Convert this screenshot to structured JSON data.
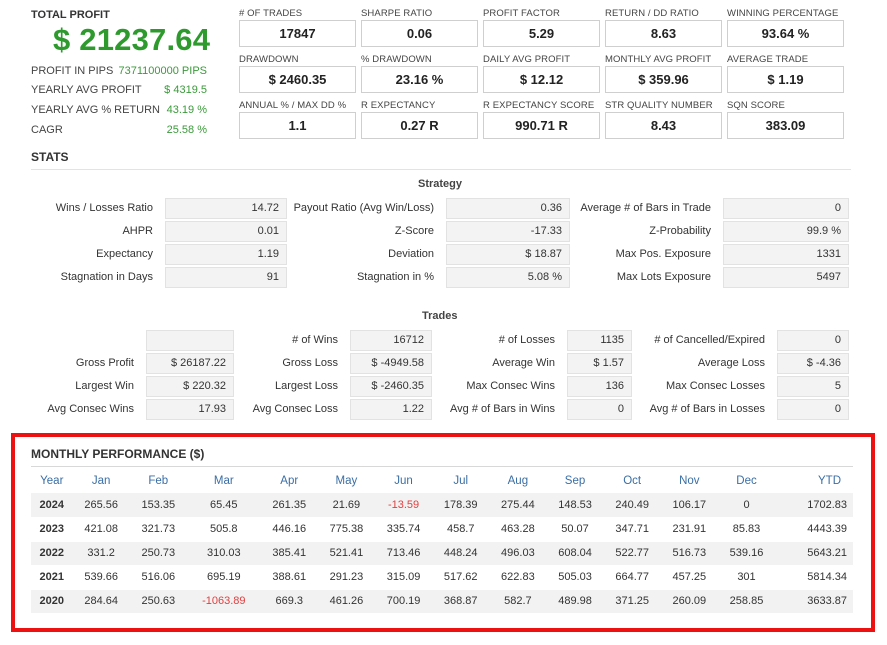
{
  "summary": {
    "total_profit_label": "TOTAL PROFIT",
    "total_profit_value": "$ 21237.64",
    "rows": [
      {
        "label": "PROFIT IN PIPS",
        "value": "7371100000 PIPS"
      },
      {
        "label": "YEARLY AVG PROFIT",
        "value": "$ 4319.5"
      },
      {
        "label": "YEARLY AVG % RETURN",
        "value": "43.19 %"
      },
      {
        "label": "CAGR",
        "value": "25.58 %"
      }
    ]
  },
  "metrics": [
    {
      "label": "# OF TRADES",
      "value": "17847"
    },
    {
      "label": "SHARPE RATIO",
      "value": "0.06"
    },
    {
      "label": "PROFIT FACTOR",
      "value": "5.29"
    },
    {
      "label": "RETURN / DD RATIO",
      "value": "8.63"
    },
    {
      "label": "WINNING PERCENTAGE",
      "value": "93.64 %"
    },
    {
      "label": "DRAWDOWN",
      "value": "$ 2460.35"
    },
    {
      "label": "% DRAWDOWN",
      "value": "23.16 %"
    },
    {
      "label": "DAILY AVG PROFIT",
      "value": "$ 12.12"
    },
    {
      "label": "MONTHLY AVG PROFIT",
      "value": "$ 359.96"
    },
    {
      "label": "AVERAGE TRADE",
      "value": "$ 1.19"
    },
    {
      "label": "ANNUAL % / MAX DD %",
      "value": "1.1"
    },
    {
      "label": "R EXPECTANCY",
      "value": "0.27 R"
    },
    {
      "label": "R EXPECTANCY SCORE",
      "value": "990.71 R"
    },
    {
      "label": "STR QUALITY NUMBER",
      "value": "8.43"
    },
    {
      "label": "SQN SCORE",
      "value": "383.09"
    }
  ],
  "stats_title": "STATS",
  "strategy": {
    "title": "Strategy",
    "rows": [
      [
        {
          "label": "Wins / Losses Ratio",
          "value": "14.72"
        },
        {
          "label": "Payout Ratio (Avg Win/Loss)",
          "value": "0.36"
        },
        {
          "label": "Average # of Bars in Trade",
          "value": "0"
        }
      ],
      [
        {
          "label": "AHPR",
          "value": "0.01"
        },
        {
          "label": "Z-Score",
          "value": "-17.33"
        },
        {
          "label": "Z-Probability",
          "value": "99.9 %"
        }
      ],
      [
        {
          "label": "Expectancy",
          "value": "1.19"
        },
        {
          "label": "Deviation",
          "value": "$ 18.87"
        },
        {
          "label": "Max Pos. Exposure",
          "value": "1331"
        }
      ],
      [
        {
          "label": "Stagnation in Days",
          "value": "91"
        },
        {
          "label": "Stagnation in %",
          "value": "5.08 %"
        },
        {
          "label": "Max Lots Exposure",
          "value": "5497"
        }
      ]
    ]
  },
  "trades": {
    "title": "Trades",
    "rows": [
      [
        {
          "label": "",
          "value": ""
        },
        {
          "label": "# of Wins",
          "value": "16712"
        },
        {
          "label": "# of Losses",
          "value": "1135"
        },
        {
          "label": "# of Cancelled/Expired",
          "value": "0"
        }
      ],
      [
        {
          "label": "Gross Profit",
          "value": "$ 26187.22"
        },
        {
          "label": "Gross Loss",
          "value": "$ -4949.58"
        },
        {
          "label": "Average Win",
          "value": "$ 1.57"
        },
        {
          "label": "Average Loss",
          "value": "$ -4.36"
        }
      ],
      [
        {
          "label": "Largest Win",
          "value": "$ 220.32"
        },
        {
          "label": "Largest Loss",
          "value": "$ -2460.35"
        },
        {
          "label": "Max Consec Wins",
          "value": "136"
        },
        {
          "label": "Max Consec Losses",
          "value": "5"
        }
      ],
      [
        {
          "label": "Avg Consec Wins",
          "value": "17.93"
        },
        {
          "label": "Avg Consec Loss",
          "value": "1.22"
        },
        {
          "label": "Avg # of Bars in Wins",
          "value": "0"
        },
        {
          "label": "Avg # of Bars in Losses",
          "value": "0"
        }
      ]
    ]
  },
  "monthly": {
    "title": "MONTHLY PERFORMANCE ($)",
    "headers": [
      "Year",
      "Jan",
      "Feb",
      "Mar",
      "Apr",
      "May",
      "Jun",
      "Jul",
      "Aug",
      "Sep",
      "Oct",
      "Nov",
      "Dec",
      "YTD"
    ],
    "rows": [
      [
        "2024",
        "265.56",
        "153.35",
        "65.45",
        "261.35",
        "21.69",
        "-13.59",
        "178.39",
        "275.44",
        "148.53",
        "240.49",
        "106.17",
        "0",
        "1702.83"
      ],
      [
        "2023",
        "421.08",
        "321.73",
        "505.8",
        "446.16",
        "775.38",
        "335.74",
        "458.7",
        "463.28",
        "50.07",
        "347.71",
        "231.91",
        "85.83",
        "4443.39"
      ],
      [
        "2022",
        "331.2",
        "250.73",
        "310.03",
        "385.41",
        "521.41",
        "713.46",
        "448.24",
        "496.03",
        "608.04",
        "522.77",
        "516.73",
        "539.16",
        "5643.21"
      ],
      [
        "2021",
        "539.66",
        "516.06",
        "695.19",
        "388.61",
        "291.23",
        "315.09",
        "517.62",
        "622.83",
        "505.03",
        "664.77",
        "457.25",
        "301",
        "5814.34"
      ],
      [
        "2020",
        "284.64",
        "250.63",
        "-1063.89",
        "669.3",
        "461.26",
        "700.19",
        "368.87",
        "582.7",
        "489.98",
        "371.25",
        "260.09",
        "258.85",
        "3633.87"
      ]
    ],
    "colors": {
      "header": "#3a6ea5",
      "negative": "#e04040",
      "highlight_frame": "#ee1111"
    }
  }
}
